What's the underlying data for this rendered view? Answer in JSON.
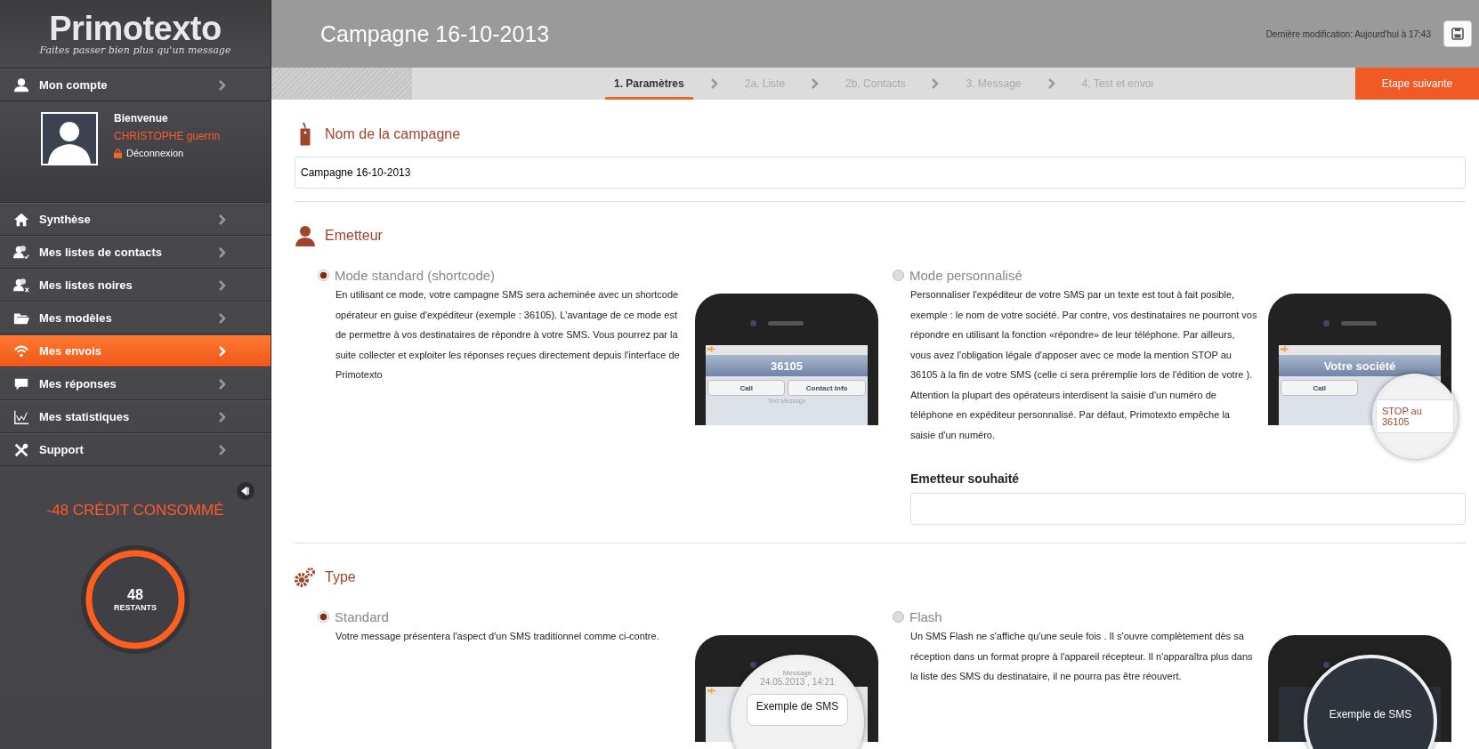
{
  "sidebar": {
    "logo": {
      "name": "Primotexto",
      "tagline": "Faites passer bien plus qu'un message"
    },
    "account": {
      "label": "Mon compte"
    },
    "profile": {
      "greeting": "Bienvenue",
      "user": "CHRISTOPHE guerrin",
      "logout": "Déconnexion"
    },
    "menu": [
      {
        "label": "Synthèse",
        "selected": false
      },
      {
        "label": "Mes listes de contacts",
        "selected": false
      },
      {
        "label": "Mes listes noires",
        "selected": false
      },
      {
        "label": "Mes modèles",
        "selected": false
      },
      {
        "label": "Mes envois",
        "selected": true
      },
      {
        "label": "Mes réponses",
        "selected": false
      },
      {
        "label": "Mes statistiques",
        "selected": false
      },
      {
        "label": "Support",
        "selected": false
      }
    ],
    "credit": {
      "consumed": "-48 CRÉDIT CONSOMMÉ",
      "remaining": "48",
      "remaining_label": "RESTANTS",
      "level": 1
    }
  },
  "header": {
    "title": "Campagne 16-10-2013",
    "last_modified": "Dernière modification: Aujourd'hui à 17:43"
  },
  "steps": [
    {
      "label": "1. Paramètres",
      "selected": true
    },
    {
      "label": "2a. Liste",
      "selected": false
    },
    {
      "label": "2b. Contacts",
      "selected": false
    },
    {
      "label": "3. Message",
      "selected": false
    },
    {
      "label": "4. Test et envoi",
      "selected": false
    }
  ],
  "next_button": "Etape suivante",
  "sections": [
    {
      "kind": "name",
      "title": "Nom de la campagne",
      "value": "Campagne 16-10-2013"
    },
    {
      "kind": "options",
      "title": "Emetteur",
      "options": [
        {
          "label": "Mode standard (shortcode)",
          "selected": true,
          "description": "En utilisant ce mode, votre campagne SMS sera acheminée avec un shortcode opérateur en guise d'expéditeur (exemple : 36105). L'avantage de ce mode est de permettre à vos destinataires de répondre à votre SMS. Vous pourrez par la suite collecter et exploiter les réponses reçues directement depuis l'interface de Primotexto",
          "phone": {
            "kind": "conversation",
            "contact": "36105",
            "buttons": [
              "Call",
              "Contact Info"
            ],
            "divider": "Text Message"
          }
        },
        {
          "label": "Mode personnalisé",
          "selected": false,
          "description": "Personnaliser l'expéditeur de votre SMS par un texte est tout à fait posible, exemple : le nom de votre société. Par contre, vos destinataires ne pourront vos répondre en utilisant la fonction «répondre» de leur téléphone. Par ailleurs, vous avez l'obligation légale d'apposer avec ce mode la mention STOP au 36105 à la fin de votre SMS (celle ci sera préremplie lors de l'édition de votre ). Attention la plupart des opérateurs interdisent la saisie d'un numéro de téléphone en expéditeur personnalisé. Par défaut, Primotexto empêche la saisie d'un numéro.",
          "phone": {
            "kind": "conversation",
            "contact": "Votre société",
            "buttons": [
              "Call"
            ],
            "zoom": "STOP au 36105"
          }
        }
      ],
      "field_label": "Emetteur souhaité"
    },
    {
      "kind": "options",
      "title": "Type",
      "options": [
        {
          "label": "Standard",
          "selected": true,
          "description": "Votre message présentera l'aspect d'un SMS traditionnel comme ci-contre.",
          "phone": {
            "kind": "zoomed_message",
            "meta": "Message",
            "date": "24.05.2013 , 14:21",
            "bubble": "Exemple de SMS"
          }
        },
        {
          "label": "Flash",
          "selected": false,
          "description": "Un SMS Flash ne s'affiche qu'une seule fois . Il s'ouvre complètement dès sa réception dans un format propre à l'appareil récepteur. Il n'apparaîtra plus dans la liste des SMS du destinataire, il ne pourra pas être réouvert.",
          "phone": {
            "kind": "flash",
            "bubble": "Exemple de SMS"
          }
        }
      ]
    }
  ]
}
